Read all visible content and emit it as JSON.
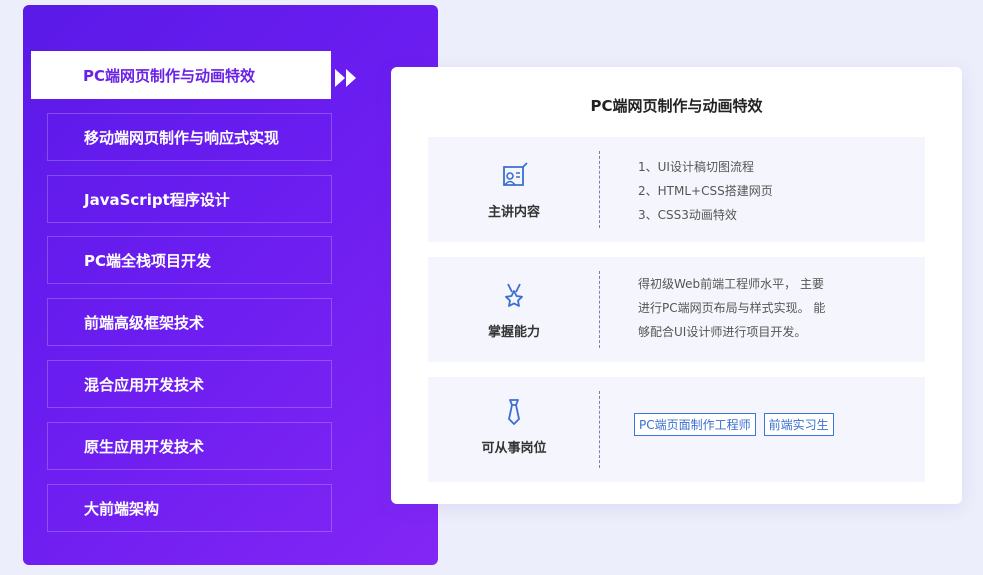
{
  "menu": {
    "items": [
      {
        "label": "PC端网页制作与动画特效",
        "active": true
      },
      {
        "label": "移动端网页制作与响应式实现",
        "active": false
      },
      {
        "label": "JavaScript程序设计",
        "active": false
      },
      {
        "label": "PC端全栈项目开发",
        "active": false
      },
      {
        "label": "前端高级框架技术",
        "active": false
      },
      {
        "label": "混合应用开发技术",
        "active": false
      },
      {
        "label": "原生应用开发技术",
        "active": false
      },
      {
        "label": "大前端架构",
        "active": false
      }
    ]
  },
  "detail": {
    "title": "PC端网页制作与动画特效",
    "main_content": {
      "label": "主讲内容",
      "icon": "design-icon",
      "items": [
        "1、UI设计稿切图流程",
        "2、HTML+CSS搭建网页",
        "3、CSS3动画特效"
      ]
    },
    "ability": {
      "label": "掌握能力",
      "icon": "medal-icon",
      "lines": [
        "得初级Web前端工程师水平， 主要",
        "进行PC端网页布局与样式实现。 能",
        "够配合UI设计师进行项目开发。"
      ]
    },
    "jobs": {
      "label": "可从事岗位",
      "icon": "tie-icon",
      "tags": [
        "PC端页面制作工程师",
        "前端实习生"
      ]
    }
  },
  "colors": {
    "panel_start": "#5a1ae8",
    "panel_end": "#8226f5",
    "active_text": "#6a22e6",
    "tag_blue": "#3a78d8"
  }
}
